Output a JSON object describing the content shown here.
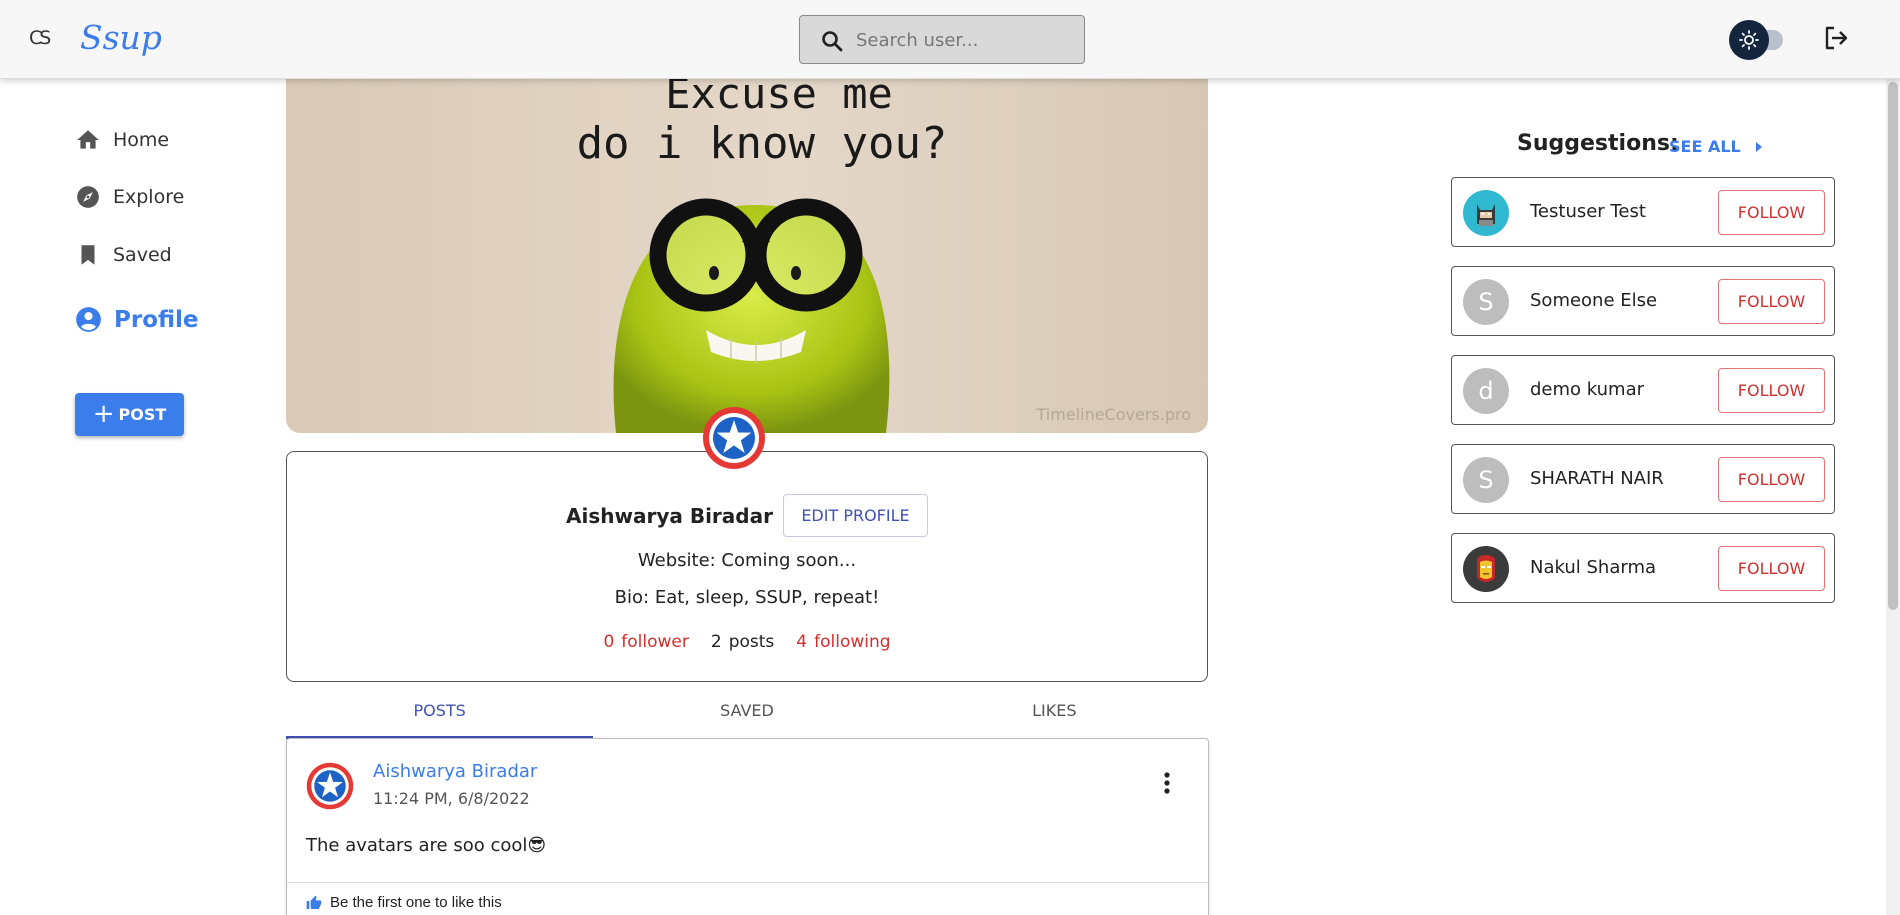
{
  "header": {
    "logo_mark": "CS",
    "app_name": "Ssup",
    "search_placeholder": "Search user...",
    "theme_toggle_icon": "sun-icon",
    "logout_icon": "logout-icon"
  },
  "nav": {
    "items": [
      {
        "label": "Home",
        "icon": "home-icon"
      },
      {
        "label": "Explore",
        "icon": "compass-icon"
      },
      {
        "label": "Saved",
        "icon": "bookmark-icon"
      },
      {
        "label": "Profile",
        "icon": "account-circle-icon",
        "active": true
      }
    ],
    "post_button": "POST"
  },
  "cover": {
    "line1": "Excuse me",
    "line2": "do i know you?",
    "watermark": "TimelineCovers.pro"
  },
  "profile": {
    "name": "Aishwarya Biradar",
    "edit_button": "EDIT PROFILE",
    "website": "Website: Coming soon...",
    "bio": "Bio: Eat, sleep, SSUP, repeat!",
    "stats": {
      "followers_count": "0",
      "followers_label": "follower",
      "posts_count": "2",
      "posts_label": "posts",
      "following_count": "4",
      "following_label": "following"
    }
  },
  "tabs": [
    {
      "label": "POSTS",
      "active": true
    },
    {
      "label": "SAVED"
    },
    {
      "label": "LIKES"
    }
  ],
  "post": {
    "author": "Aishwarya Biradar",
    "time": "11:24 PM, 6/8/2022",
    "text": "The avatars are soo cool😎",
    "likes_text": "Be the first one to like this"
  },
  "suggestions": {
    "title": "Suggestions:",
    "see_all": "SEE ALL",
    "follow_label": "FOLLOW",
    "users": [
      {
        "name": "Testuser Test",
        "initial": "",
        "avatar": "batman-avatar"
      },
      {
        "name": "Someone Else",
        "initial": "S"
      },
      {
        "name": "demo kumar",
        "initial": "d"
      },
      {
        "name": "SHARATH NAIR",
        "initial": "S"
      },
      {
        "name": "Nakul Sharma",
        "initial": "",
        "avatar": "ironman-avatar"
      }
    ]
  },
  "colors": {
    "accent": "#3b7dea",
    "follow_red": "#d32f2f",
    "tab_indigo": "#3f51b5"
  }
}
